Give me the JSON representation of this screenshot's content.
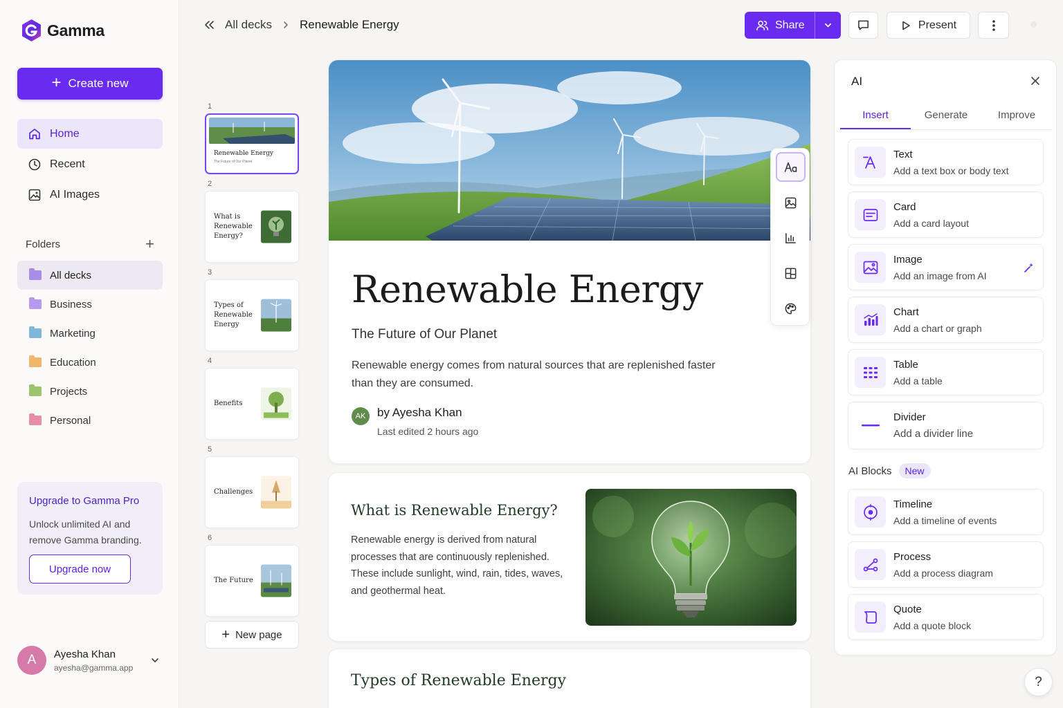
{
  "app": {
    "name": "Gamma"
  },
  "sidebar": {
    "create_label": "Create new",
    "nav": [
      {
        "label": "Home",
        "icon": "home-icon"
      },
      {
        "label": "Recent",
        "icon": "clock-icon"
      },
      {
        "label": "AI Images",
        "icon": "ai-image-icon"
      }
    ],
    "folders_label": "Folders",
    "folders": [
      {
        "label": "All decks",
        "color": "#a98be8"
      },
      {
        "label": "Business",
        "color": "#b79af0"
      },
      {
        "label": "Marketing",
        "color": "#7fb7d9"
      },
      {
        "label": "Education",
        "color": "#f0b66a"
      },
      {
        "label": "Projects",
        "color": "#9cc36d"
      },
      {
        "label": "Personal",
        "color": "#e58fa4"
      }
    ],
    "upgrade": {
      "title": "Upgrade to Gamma Pro",
      "desc": "Unlock unlimited AI and remove Gamma branding.",
      "button": "Upgrade now"
    },
    "user": {
      "initial": "A",
      "name": "Ayesha Khan",
      "email": "ayesha@gamma.app"
    }
  },
  "header": {
    "breadcrumb_parent": "All decks",
    "breadcrumb_current": "Renewable Energy",
    "share_label": "Share",
    "present_label": "Present"
  },
  "thumbnails": [
    {
      "num": "1",
      "title": "Renewable Energy",
      "subtitle": "The Future of Our Planet"
    },
    {
      "num": "2",
      "title": "What is Renewable Energy?"
    },
    {
      "num": "3",
      "title": "Types of Renewable Energy"
    },
    {
      "num": "4",
      "title": "Benefits"
    },
    {
      "num": "5",
      "title": "Challenges"
    },
    {
      "num": "6",
      "title": "The Future"
    }
  ],
  "new_page_label": "New page",
  "hero": {
    "title": "Renewable Energy",
    "subtitle": "The Future of Our Planet",
    "body": "Renewable energy comes from natural sources that are replenished faster than they are consumed.",
    "author_initials": "AK",
    "author": "by Ayesha Khan",
    "edited": "Last edited 2 hours ago"
  },
  "section_what": {
    "title": "What is Renewable Energy?",
    "body": "Renewable energy is derived from natural processes that are continuously replenished. These include sunlight, wind, rain, tides, waves, and geothermal heat."
  },
  "section_types": {
    "title": "Types of Renewable Energy"
  },
  "ai_panel": {
    "title": "AI",
    "tabs": [
      "Insert",
      "Generate",
      "Improve"
    ],
    "items": [
      {
        "title": "Text",
        "desc": "Add a text box or body text",
        "icon": "text-icon"
      },
      {
        "title": "Card",
        "desc": "Add a card layout",
        "icon": "card-icon"
      },
      {
        "title": "Image",
        "desc": "Add an image from AI",
        "icon": "image-icon"
      },
      {
        "title": "Chart",
        "desc": "Add a chart or graph",
        "icon": "chart-icon"
      },
      {
        "title": "Table",
        "desc": "Add a table",
        "icon": "table-icon"
      },
      {
        "title": "Divider",
        "desc": "Add a divider line",
        "icon": "divider-icon"
      }
    ],
    "blocks_label": "AI Blocks",
    "blocks_badge": "New",
    "blocks": [
      {
        "title": "Timeline",
        "desc": "Add a timeline of events",
        "icon": "timeline-icon"
      },
      {
        "title": "Process",
        "desc": "Add a process diagram",
        "icon": "process-icon"
      },
      {
        "title": "Quote",
        "desc": "Add a quote block",
        "icon": "quote-icon"
      }
    ]
  },
  "help_label": "?",
  "colors": {
    "accent": "#6a2bf0",
    "accent_soft": "#ece6fb"
  }
}
